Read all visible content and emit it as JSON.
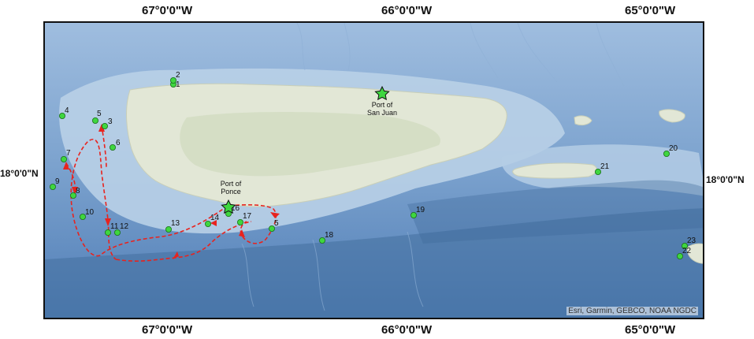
{
  "axes": {
    "top": [
      "67°0'0\"W",
      "66°0'0\"W",
      "65°0'0\"W"
    ],
    "bottom": [
      "67°0'0\"W",
      "66°0'0\"W",
      "65°0'0\"W"
    ],
    "left": "18°0'0\"N",
    "right": "18°0'0\"N"
  },
  "ports": [
    {
      "id": "port-san-juan",
      "line1": "Port of",
      "line2": "San Juan"
    },
    {
      "id": "port-ponce",
      "line1": "Port of",
      "line2": "Ponce"
    }
  ],
  "stations": [
    "1",
    "2",
    "3",
    "4",
    "5",
    "6",
    "7",
    "8",
    "9",
    "10",
    "11",
    "12",
    "13",
    "14",
    "5",
    "16",
    "17",
    "18",
    "19",
    "20",
    "21",
    "22",
    "23"
  ],
  "attribution": "Esri, Garmin, GEBCO, NOAA NGDC",
  "colors": {
    "station": "#3fd63f",
    "route": "#e8231e",
    "port_star": "#3fd63f",
    "land": "#e3e6d4",
    "shallow": "#bcd3e8",
    "deep": "#5f88bd"
  }
}
